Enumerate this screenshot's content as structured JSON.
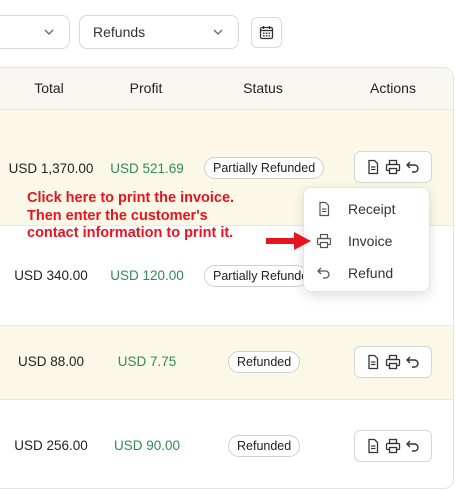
{
  "filters": {
    "left_value": "",
    "refunds_value": "Refunds"
  },
  "table": {
    "headers": {
      "total": "Total",
      "profit": "Profit",
      "status": "Status",
      "actions": "Actions"
    },
    "rows": [
      {
        "total": "USD 1,370.00",
        "profit": "USD 521.69",
        "status": "Partially Refunded"
      },
      {
        "total": "USD 340.00",
        "profit": "USD 120.00",
        "status": "Partially Refunded"
      },
      {
        "total": "USD 88.00",
        "profit": "USD 7.75",
        "status": "Refunded"
      },
      {
        "total": "USD 256.00",
        "profit": "USD 90.00",
        "status": "Refunded"
      }
    ]
  },
  "menu": {
    "receipt": "Receipt",
    "invoice": "Invoice",
    "refund": "Refund"
  },
  "annotation": {
    "line1": "Click here to print the invoice.",
    "line2": "Then enter the customer's",
    "line3": "contact information to print it."
  },
  "colors": {
    "profit": "#2e8b57",
    "annotation": "#e8131e",
    "highlight_row": "#fcf8e8"
  }
}
